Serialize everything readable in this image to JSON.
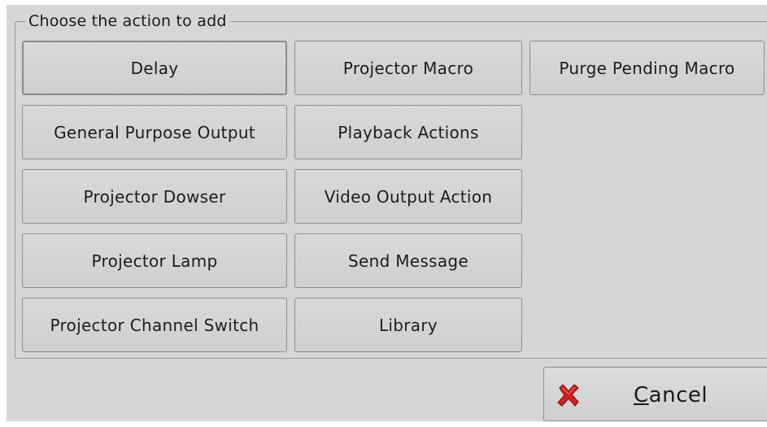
{
  "dialog": {
    "group_title": "Choose the action to add",
    "actions": [
      "Delay",
      "Projector Macro",
      "Purge Pending Macro",
      "General Purpose Output",
      "Playback Actions",
      "Projector Dowser",
      "Video Output Action",
      "Projector Lamp",
      "Send Message",
      "Projector Channel Switch",
      "Library"
    ],
    "cancel_label_mnemonic": "C",
    "cancel_label_rest": "ancel",
    "cancel_icon": "red-x-icon",
    "cancel_icon_color": "#d62020"
  }
}
